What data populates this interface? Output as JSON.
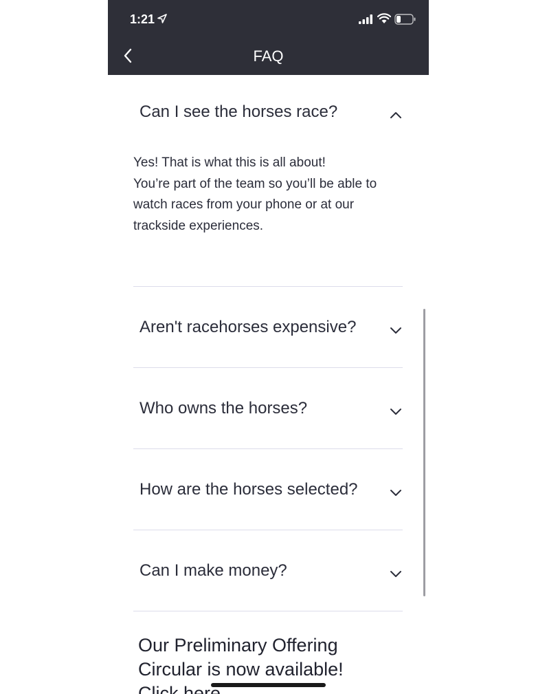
{
  "status_bar": {
    "time": "1:21",
    "icons": [
      "location-arrow-icon",
      "cellular-signal-icon",
      "wifi-icon",
      "battery-icon"
    ]
  },
  "header": {
    "title": "FAQ",
    "back_icon": "chevron-left-icon"
  },
  "colors": {
    "header_bg": "#2e2f38",
    "text": "#2b2d3a",
    "divider": "#dcdcea"
  },
  "faq": {
    "items": [
      {
        "question": "Can I see the horses race?",
        "expanded": true,
        "answer_lines": [
          "Yes! That is what this is all about!",
          "You’re part of the team so you’ll be able to",
          "watch races from your phone or at our",
          "trackside experiences."
        ]
      },
      {
        "question": "Aren't racehorses expensive?",
        "expanded": false
      },
      {
        "question": "Who owns the horses?",
        "expanded": false
      },
      {
        "question": "How are the horses selected?",
        "expanded": false
      },
      {
        "question": "Can I make money?",
        "expanded": false
      }
    ]
  },
  "promo": {
    "lines": [
      "Our Preliminary Offering",
      "Circular is now available!",
      "Click here"
    ]
  }
}
